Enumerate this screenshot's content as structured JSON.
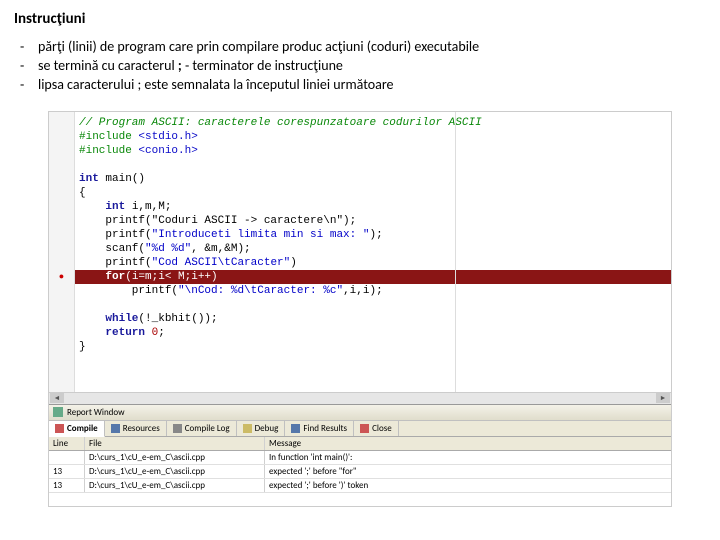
{
  "heading": "Instrucţiuni",
  "bullets": [
    "părţi (linii) de program care prin compilare produc acţiuni (coduri) executabile",
    "se termină cu caracterul ; - terminator de instrucţiune",
    "lipsa caracterului ; este semnalata la începutul liniei următoare"
  ],
  "bullets_html": [
    "părţi (linii) de program care prin compilare produc acţiuni (coduri) executabile",
    "se termină cu caracterul <strong>;</strong> - terminator de instrucţiune",
    "lipsa caracterului ; este semnalata la începutul liniei următoare"
  ],
  "code": {
    "lines": [
      "// Program ASCII: caracterele corespunzatoare codurilor ASCII",
      "#include <stdio.h>",
      "#include <conio.h>",
      "",
      "int main()",
      "{",
      "    int i,m,M;",
      "    printf(\"Coduri ASCII -> caractere\\n\");",
      "    printf(\"Introduceti limita min si max: \");",
      "    scanf(\"%d %d\", &m,&M);",
      "    printf(\"Cod ASCII\\tCaracter\")",
      "    for(i=m;i< M;i++)",
      "        printf(\"\\nCod: %d\\tCaracter: %c\",i,i);",
      "",
      "    while(!_kbhit());",
      "    return 0;",
      "}"
    ],
    "highlight_index": 11,
    "error_mark_index": 11
  },
  "panel": {
    "title": "Report Window",
    "tabs": [
      {
        "label": "Compile",
        "icon": "red",
        "active": true
      },
      {
        "label": "Resources",
        "icon": "blue"
      },
      {
        "label": "Compile Log",
        "icon": "gray"
      },
      {
        "label": "Debug",
        "icon": "yel"
      },
      {
        "label": "Find Results",
        "icon": "blue"
      },
      {
        "label": "Close",
        "icon": "red"
      }
    ],
    "columns": [
      "Line",
      "File",
      "Message"
    ],
    "rows": [
      {
        "line": "",
        "file": "D:\\curs_1\\cU_e-em_C\\ascii.cpp",
        "msg": "In function 'int main()':"
      },
      {
        "line": "13",
        "file": "D:\\curs_1\\cU_e-em_C\\ascii.cpp",
        "msg": "expected ';' before \"for\""
      },
      {
        "line": "13",
        "file": "D:\\curs_1\\cU_e-em_C\\ascii.cpp",
        "msg": "expected ';' before ')' token"
      }
    ]
  }
}
